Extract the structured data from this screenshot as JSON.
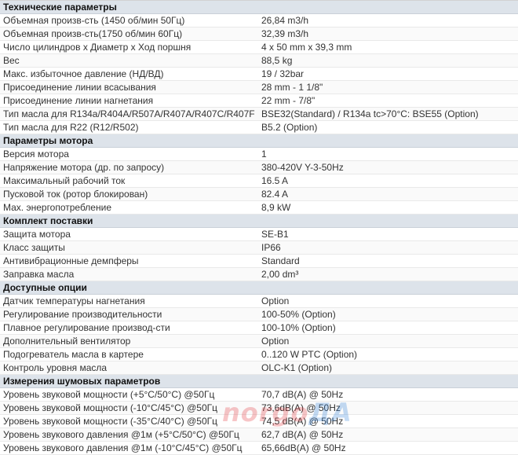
{
  "sections": [
    {
      "title": "Технические параметры",
      "rows": [
        {
          "label": "Объемная произв-сть (1450 об/мин 50Гц)",
          "value": "26,84 m3/h"
        },
        {
          "label": "Объемная произв-сть(1750 об/мин 60Гц)",
          "value": "32,39 m3/h"
        },
        {
          "label": "Число цилиндров х Диаметр х Ход поршня",
          "value": "4 x 50 mm x 39,3 mm"
        },
        {
          "label": "Вес",
          "value": "88,5 kg"
        },
        {
          "label": "Макс. избыточное давление (НД/ВД)",
          "value": "19 / 32bar"
        },
        {
          "label": "Присоединение линии всасывания",
          "value": "28 mm - 1 1/8\""
        },
        {
          "label": "Присоединение линии нагнетания",
          "value": "22 mm - 7/8\""
        },
        {
          "label": "Тип масла для R134a/R404A/R507A/R407A/R407C/R407F",
          "value": "BSE32(Standard) / R134a tc>70°C: BSE55 (Option)"
        },
        {
          "label": "Тип масла для R22 (R12/R502)",
          "value": "B5.2 (Option)"
        }
      ]
    },
    {
      "title": "Параметры мотора",
      "rows": [
        {
          "label": "Версия мотора",
          "value": "1"
        },
        {
          "label": "Напряжение мотора (др. по запросу)",
          "value": "380-420V Y-3-50Hz"
        },
        {
          "label": "Максимальный рабочий ток",
          "value": "16.5 A"
        },
        {
          "label": "Пусковой ток (ротор блокирован)",
          "value": "82.4 A"
        },
        {
          "label": "Мах. энергопотребление",
          "value": "8,9 kW"
        }
      ]
    },
    {
      "title": "Комплект поставки",
      "rows": [
        {
          "label": "Защита мотора",
          "value": "SE-B1"
        },
        {
          "label": "Класс защиты",
          "value": "IP66"
        },
        {
          "label": "Антивибрационные демпферы",
          "value": "Standard"
        },
        {
          "label": "Заправка масла",
          "value": "2,00 dm³"
        }
      ]
    },
    {
      "title": "Доступные опции",
      "rows": [
        {
          "label": "Датчик температуры нагнетания",
          "value": "Option"
        },
        {
          "label": "Регулирование производительности",
          "value": "100-50% (Option)"
        },
        {
          "label": "Плавное регулирование производ-сти",
          "value": "100-10% (Option)"
        },
        {
          "label": "Дополнительный вентилятор",
          "value": "Option"
        },
        {
          "label": "Подогреватель масла в картере",
          "value": "0..120 W PTC (Option)"
        },
        {
          "label": "Контроль уровня масла",
          "value": "OLC-K1 (Option)"
        }
      ]
    },
    {
      "title": "Измерения шумовых параметров",
      "rows": [
        {
          "label": "Уровень звуковой мощности (+5°C/50°C) @50Гц",
          "value": "70,7 dB(A) @ 50Hz"
        },
        {
          "label": "Уровень звуковой мощности (-10°C/45°C) @50Гц",
          "value": "73,6dB(A) @ 50Hz"
        },
        {
          "label": "Уровень звуковой мощности (-35°C/40°C) @50Гц",
          "value": "74,5 dB(A) @ 50Hz"
        },
        {
          "label": "Уровень звукового давления @1м (+5°C/50°C) @50Гц",
          "value": "62,7 dB(A) @ 50Hz"
        },
        {
          "label": "Уровень звукового давления @1м (-10°C/45°C) @50Гц",
          "value": "65,66dB(A) @ 50Hz"
        }
      ]
    }
  ],
  "watermark": {
    "part_a": "norgo",
    "part_b": "ДА"
  },
  "colors": {
    "header_bg": "#dde3ea",
    "text": "#333333",
    "watermark_red": "#e3343a",
    "watermark_blue": "#2f7fd8"
  }
}
